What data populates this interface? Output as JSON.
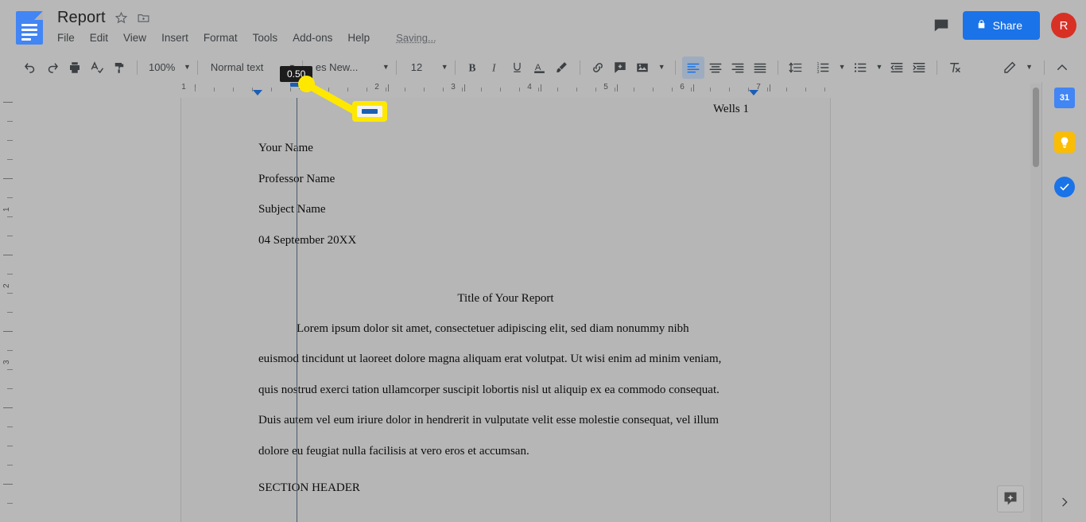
{
  "app": {
    "doc_title": "Report",
    "saving_status": "Saving...",
    "share_label": "Share",
    "avatar_initial": "R",
    "accent_blue": "#1a73e8",
    "avatar_color": "#d93025",
    "annotation_yellow": "#ffe800",
    "marker_blue": "#1a5fb4"
  },
  "menubar": {
    "items": [
      {
        "label": "File"
      },
      {
        "label": "Edit"
      },
      {
        "label": "View"
      },
      {
        "label": "Insert"
      },
      {
        "label": "Format"
      },
      {
        "label": "Tools"
      },
      {
        "label": "Add-ons"
      },
      {
        "label": "Help"
      }
    ]
  },
  "toolbar": {
    "zoom_value": "100%",
    "style_value": "Normal text",
    "font_value": "es New...",
    "size_value": "12",
    "icons": [
      "undo-icon",
      "redo-icon",
      "print-icon",
      "spellcheck-icon",
      "paint-format-icon",
      "bold-icon",
      "italic-icon",
      "underline-icon",
      "text-color-icon",
      "highlight-icon",
      "link-icon",
      "comment-icon",
      "image-icon",
      "align-left-icon",
      "align-center-icon",
      "align-right-icon",
      "align-justify-icon",
      "line-spacing-icon",
      "numbered-list-icon",
      "bulleted-list-icon",
      "decrease-indent-icon",
      "increase-indent-icon",
      "clear-formatting-icon",
      "edit-mode-icon",
      "collapse-toolbar-icon"
    ]
  },
  "ruler": {
    "tooltip_value": "0.50",
    "horizontal_numbers": [
      "1",
      "1",
      "2",
      "3",
      "4",
      "5",
      "6",
      "7"
    ],
    "vertical_numbers": [
      "1",
      "2",
      "3"
    ]
  },
  "annotation": {
    "callout_label": "first-line-indent-marker"
  },
  "document": {
    "header_right": "Wells 1",
    "meta_lines": [
      "Your Name",
      "Professor Name",
      "Subject Name",
      "04 September 20XX"
    ],
    "title": "Title of Your Report",
    "paragraph_lines": [
      "Lorem ipsum dolor sit amet, consectetuer adipiscing elit, sed diam nonummy nibh",
      "euismod tincidunt ut laoreet dolore magna aliquam erat volutpat. Ut wisi enim ad minim veniam,",
      "quis nostrud exerci tation ullamcorper suscipit lobortis nisl ut aliquip ex ea commodo consequat.",
      "Duis autem vel eum iriure dolor in hendrerit in vulputate velit esse molestie consequat, vel illum",
      "dolore eu feugiat nulla facilisis at vero eros et accumsan."
    ],
    "section_header": "SECTION HEADER"
  },
  "right_rail": {
    "calendar_label": "31",
    "items": [
      "calendar-icon",
      "keep-icon",
      "tasks-icon"
    ]
  }
}
